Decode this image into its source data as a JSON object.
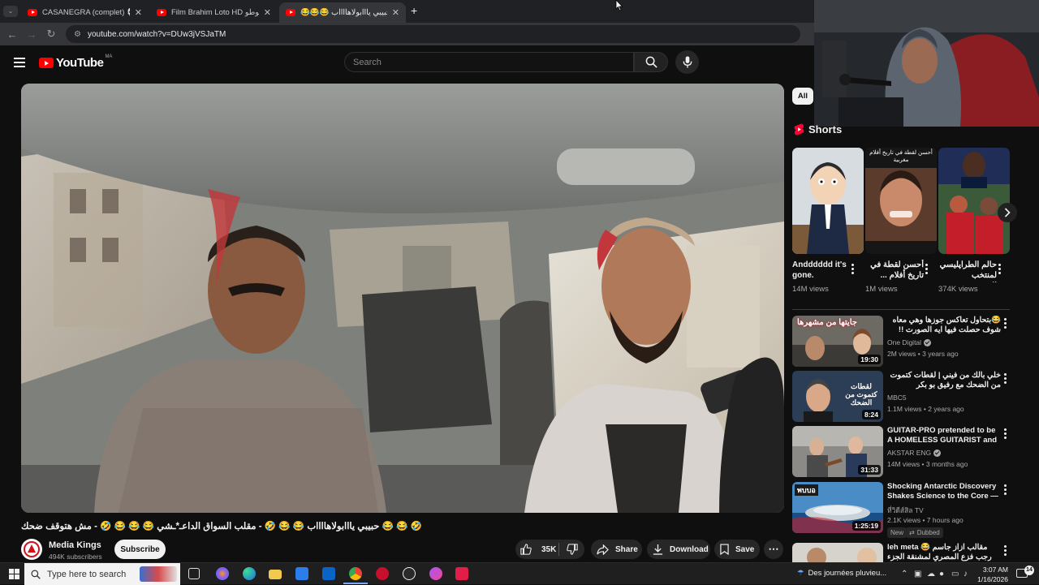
{
  "browser": {
    "tabs": [
      {
        "title": "CASANEGRA (complet) 💀🎬 |",
        "active": false
      },
      {
        "title": "Film Brahim Loto HD فيلم إبراهيم لوطو",
        "active": false
      },
      {
        "title": "😂😂😂 حبيبي يااابولاهااااب",
        "active": true
      }
    ],
    "new_tab_symbol": "+",
    "url": "youtube.com/watch?v=DUw3jVSJaTM"
  },
  "youtube": {
    "logo_text": "YouTube",
    "country_code": "MA",
    "search_placeholder": "Search"
  },
  "video": {
    "title": "🤣 😂 😂 حبيبي يااابولاهااااب 😂 😂 🤣 - مقلب السواق الداعـ*ـشي 😂 😂 😂 🤣 - مش هتوقف ضحك",
    "channel": "Media Kings",
    "subscribers": "494K subscribers",
    "subscribe_label": "Subscribe",
    "likes": "35K",
    "share_label": "Share",
    "download_label": "Download",
    "save_label": "Save"
  },
  "sidebar": {
    "chip_all": "All",
    "shorts_label": "Shorts",
    "shorts": [
      {
        "title": "Andddddd it's gone.",
        "views": "14M views",
        "thumb_text": ""
      },
      {
        "title": "أحسن لقطة في تاريخ أفلام ...",
        "views": "1M views",
        "thumb_text": "أحسن لقطة في تاريخ أفلام مغربية"
      },
      {
        "title": "حالم الطراپليسي لمنتخب المغربي...",
        "views": "374K views",
        "thumb_text": ""
      }
    ],
    "recommended": [
      {
        "title": "😂بتحاول تعاكس جوزها وهي معاه شوف حصلت فيها ايه الصورت !!",
        "channel": "One Digital",
        "verified": true,
        "meta": "2M views • 3 years ago",
        "duration": "19:30",
        "thumb_text": "جايتها من مشهرها",
        "badges": []
      },
      {
        "title": "خلي بالك من فيني | لقطات كتموت من الضحك مع رفيق بو بكر",
        "channel": "MBC5",
        "verified": false,
        "meta": "1.1M views • 2 years ago",
        "duration": "8:24",
        "thumb_text": "لقطات كتموت من الضحك",
        "badges": []
      },
      {
        "title": "GUITAR-PRO pretended to be A HOMELESS GUITARIST and ...",
        "channel": "AKSTAR ENG",
        "verified": true,
        "meta": "14M views • 3 months ago",
        "duration": "31:33",
        "thumb_text": "",
        "badges": []
      },
      {
        "title": "Shocking Antarctic Discovery Shakes Science to the Core — ...",
        "channel": "ที่วิดีส์สิล TV",
        "verified": false,
        "meta": "2.1K views • 7 hours ago",
        "duration": "1:25:19",
        "thumb_text": "พบบอ",
        "badges": [
          "New",
          "Dubbed"
        ]
      },
      {
        "title": "leh meta 😂 مقالب ازاز جاسم رجب فزع المصري لمشنقة الجزء الثاني",
        "channel": "",
        "verified": false,
        "meta": "",
        "duration": "",
        "thumb_text": "",
        "badges": []
      }
    ]
  },
  "taskbar": {
    "search_placeholder": "Type here to search",
    "weather": "Des journées pluvieu...",
    "time": "3:07 AM",
    "date": "1/16/2026",
    "notification_count": "14"
  }
}
